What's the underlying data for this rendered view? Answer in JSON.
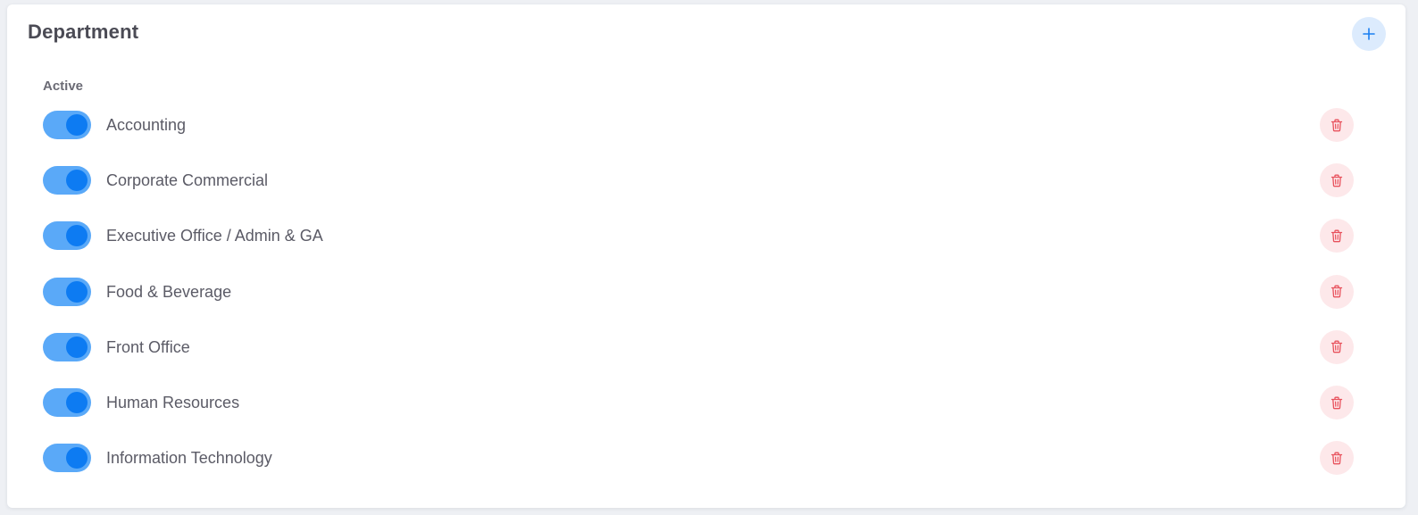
{
  "panel": {
    "title": "Department",
    "add_icon": "plus-icon",
    "section_label": "Active"
  },
  "colors": {
    "toggle_track": "#5aa9f8",
    "toggle_knob": "#0d7bf2",
    "delete_bg": "#fde8ea",
    "delete_icon": "#e8515c",
    "add_bg": "#dcebfd",
    "add_icon": "#1a7ff2"
  },
  "departments": [
    {
      "label": "Accounting",
      "active": true,
      "delete_icon": "trash-icon"
    },
    {
      "label": "Corporate Commercial",
      "active": true,
      "delete_icon": "trash-icon"
    },
    {
      "label": "Executive Office / Admin & GA",
      "active": true,
      "delete_icon": "trash-icon"
    },
    {
      "label": "Food & Beverage",
      "active": true,
      "delete_icon": "trash-icon"
    },
    {
      "label": "Front Office",
      "active": true,
      "delete_icon": "trash-icon"
    },
    {
      "label": "Human Resources",
      "active": true,
      "delete_icon": "trash-icon"
    },
    {
      "label": "Information Technology",
      "active": true,
      "delete_icon": "trash-icon"
    }
  ]
}
